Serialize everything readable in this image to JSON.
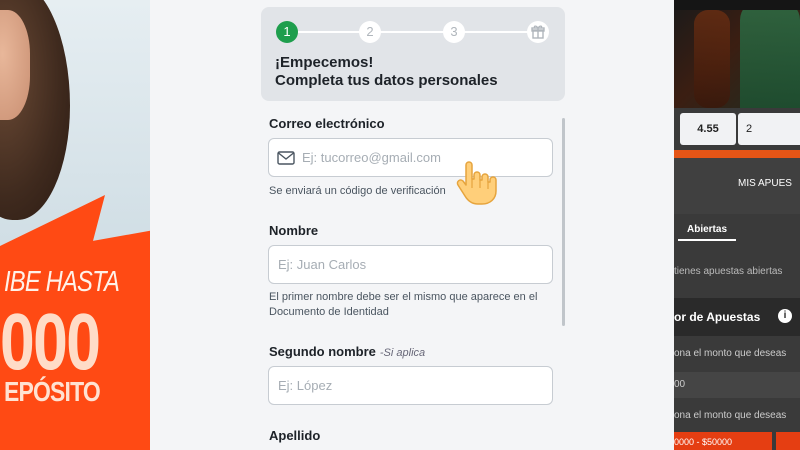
{
  "promo": {
    "line1": "IBE HASTA",
    "line2": "000",
    "line3": "EPÓSITO"
  },
  "background_right": {
    "odds": [
      "4.55",
      "2"
    ],
    "mis_apuestas": "MIS APUES",
    "tab_abiertas": "Abiertas",
    "sub_text": "tienes apuestas abiertas",
    "calc_title": "or de Apuestas",
    "select_text_1": "ona el monto que deseas",
    "input_value": "00",
    "select_text_2": "ona el monto que deseas",
    "range_text": "0000 - $50000"
  },
  "stepper": {
    "steps": [
      "1",
      "2",
      "3"
    ],
    "final_icon": "gift-icon",
    "title": "¡Empecemos!",
    "subtitle": "Completa tus datos personales",
    "active_color": "#1e9e4d"
  },
  "form": {
    "email": {
      "label": "Correo electrónico",
      "placeholder": "Ej: tucorreo@gmail.com",
      "help": "Se enviará un código de verificación",
      "icon": "mail-icon"
    },
    "nombre": {
      "label": "Nombre",
      "placeholder": "Ej: Juan Carlos",
      "help": "El primer nombre debe ser el mismo que aparece en el Documento de Identidad"
    },
    "segundo_nombre": {
      "label": "Segundo nombre",
      "optional": "-Si aplica",
      "placeholder": "Ej: López"
    },
    "apellido": {
      "label": "Apellido"
    }
  },
  "cursor": "hand-pointer-icon"
}
